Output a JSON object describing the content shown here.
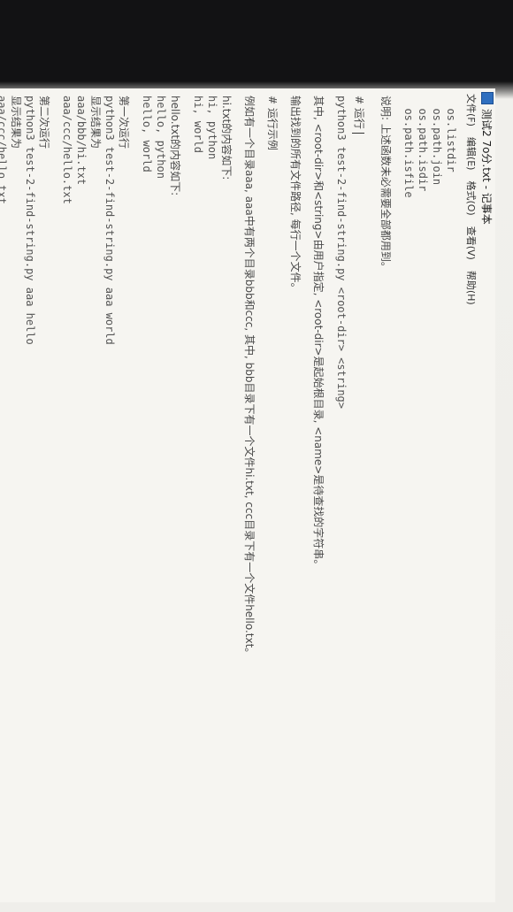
{
  "window": {
    "title": "测试2 7o分.txt - 记事本",
    "icon": "notepad-icon",
    "menu": [
      "文件(F)",
      "编辑(E)",
      "格式(O)",
      "查看(V)",
      "帮助(H)"
    ]
  },
  "editor": {
    "lines": [
      "  os.listdir",
      "  os.path.join",
      "  os.path.isdir",
      "  os.path.isfile",
      "",
      "说明: 上述函数未必需要全部都用到。",
      "",
      "# 运行",
      "python3 test-2-find-string.py <root-dir> <string>",
      "",
      "其中, <root-dir>和<string>由用户指定, <root-dir>是起始根目录, <name>是待查找的字符串。",
      "",
      "输出找到的所有文件路径, 每行一个文件。",
      "",
      "# 运行示例",
      "",
      "例如有一个目录aaa, aaa中有两个目录bbb和ccc, 其中, bbb目录下有一个文件hi.txt, ccc目录下有一个文件hello.txt。",
      "",
      "hi.txt的内容如下:",
      "hi, python",
      "hi, world",
      "",
      "hello.txt的内容如下:",
      "hello, python",
      "hello, world",
      "",
      "第一次运行",
      "python3 test-2-find-string.py aaa world",
      "显示结果为",
      "aaa/bbb/hi.txt",
      "aaa/ccc/hello.txt",
      "",
      "第二次运行",
      "python3 test-2-find-string.py aaa hello",
      "显示结果为",
      "aaa/ccc/hello.txt"
    ]
  }
}
